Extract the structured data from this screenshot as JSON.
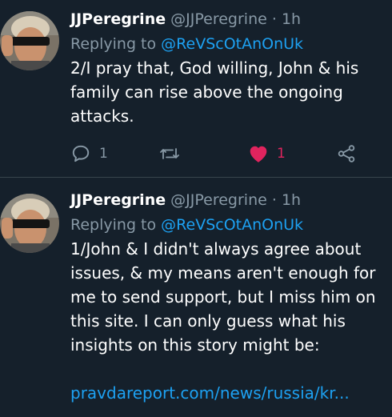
{
  "tweets": [
    {
      "author_name": "JJPeregrine",
      "handle": "@JJPeregrine",
      "separator": "·",
      "time": "1h",
      "replying_prefix": "Replying to",
      "replying_to": "@ReVScOtAnOnUk",
      "text_lines": [
        "2/I pray that, God willing, John & his",
        "family can rise above the ongoing",
        "attacks."
      ],
      "reply_count": "1",
      "like_count": "1",
      "liked": true
    },
    {
      "author_name": "JJPeregrine",
      "handle": "@JJPeregrine",
      "separator": "·",
      "time": "1h",
      "replying_prefix": "Replying to",
      "replying_to": "@ReVScOtAnOnUk",
      "text_lines": [
        "1/John & I didn't always agree about",
        "issues, & my means aren't enough for",
        "me to send support, but I miss him on",
        "this site. I can only guess what his",
        "insights on this story might be:"
      ],
      "link": "pravdareport.com/news/russia/kr..."
    }
  ],
  "colors": {
    "background": "#15202b",
    "text": "#ffffff",
    "muted": "#8899a6",
    "accent": "#1da1f2",
    "like": "#e0245e"
  },
  "icons": [
    "reply-icon",
    "retweet-icon",
    "heart-icon",
    "share-icon"
  ]
}
